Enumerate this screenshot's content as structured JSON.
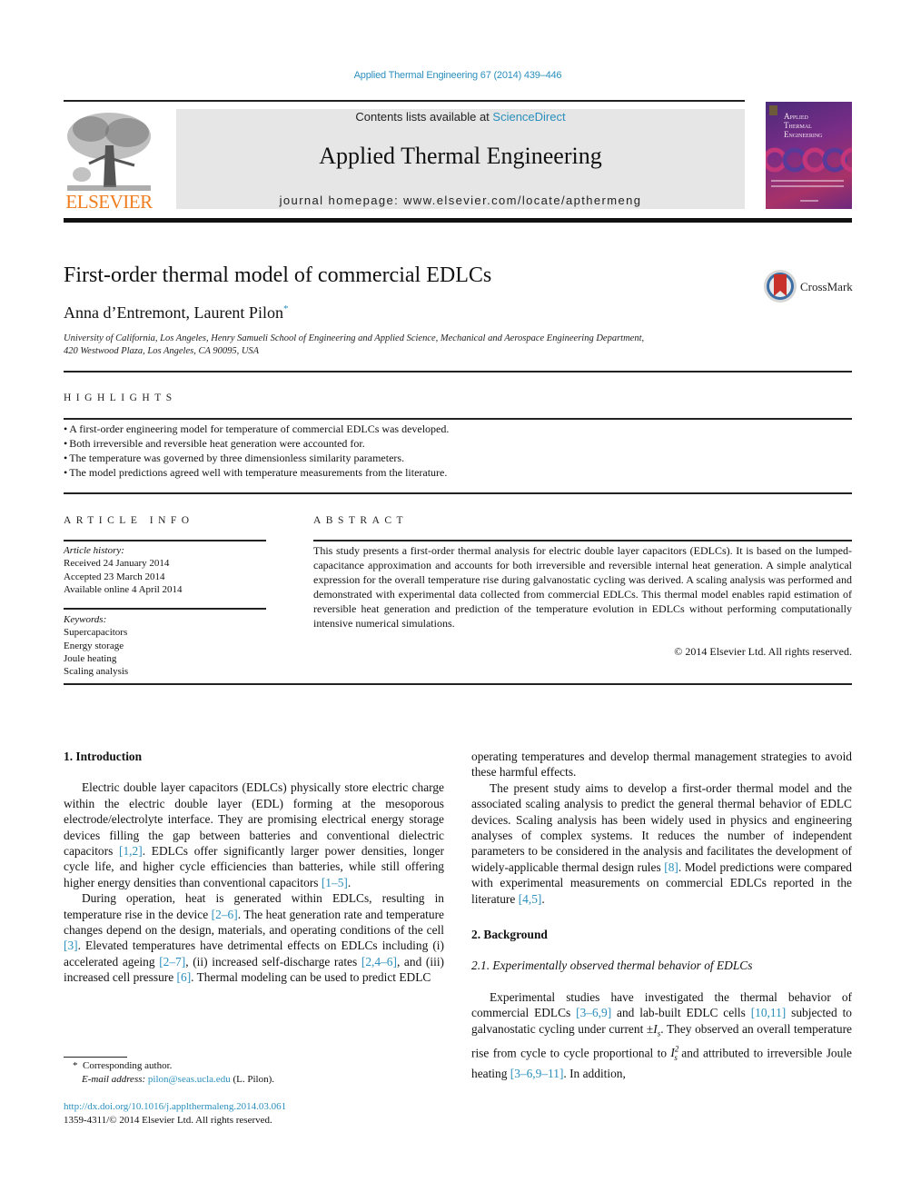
{
  "header": {
    "journal_ref": "Applied Thermal Engineering 67 (2014) 439–446",
    "contents_prefix": "Contents lists available at ",
    "contents_link": "ScienceDirect",
    "journal_name": "Applied Thermal Engineering",
    "homepage_prefix": "journal homepage: ",
    "homepage_url": "www.elsevier.com/locate/apthermeng",
    "publisher_logo_text": "ELSEVIER",
    "cover_title_lines": [
      "Applied",
      "Thermal",
      "Engineering"
    ],
    "brand_color": "#f07d1e",
    "link_color": "#2a8fbd"
  },
  "article": {
    "title": "First-order thermal model of commercial EDLCs",
    "authors": "Anna d’Entremont, Laurent Pilon",
    "author_mark": "*",
    "crossmark_label": "CrossMark",
    "affiliation_line1": "University of California, Los Angeles, Henry Samueli School of Engineering and Applied Science, Mechanical and Aerospace Engineering Department,",
    "affiliation_line2": "420 Westwood Plaza, Los Angeles, CA 90095, USA"
  },
  "highlights": {
    "heading": "HIGHLIGHTS",
    "items": [
      "A first-order engineering model for temperature of commercial EDLCs was developed.",
      "Both irreversible and reversible heat generation were accounted for.",
      "The temperature was governed by three dimensionless similarity parameters.",
      "The model predictions agreed well with temperature measurements from the literature."
    ]
  },
  "article_info": {
    "heading": "ARTICLE INFO",
    "history_label": "Article history:",
    "history": [
      "Received 24 January 2014",
      "Accepted 23 March 2014",
      "Available online 4 April 2014"
    ],
    "keywords_label": "Keywords:",
    "keywords": [
      "Supercapacitors",
      "Energy storage",
      "Joule heating",
      "Scaling analysis"
    ]
  },
  "abstract": {
    "heading": "ABSTRACT",
    "text": "This study presents a first-order thermal analysis for electric double layer capacitors (EDLCs). It is based on the lumped-capacitance approximation and accounts for both irreversible and reversible internal heat generation. A simple analytical expression for the overall temperature rise during galvanostatic cycling was derived. A scaling analysis was performed and demonstrated with experimental data collected from commercial EDLCs. This thermal model enables rapid estimation of reversible heat generation and prediction of the temperature evolution in EDLCs without performing computationally intensive numerical simulations.",
    "copyright": "© 2014 Elsevier Ltd. All rights reserved."
  },
  "body": {
    "sec1_heading": "1.  Introduction",
    "p1": [
      {
        "t": "Electric double layer capacitors (EDLCs) physically store electric charge within the electric double layer (EDL) forming at the mesoporous electrode/electrolyte interface. They are promising electrical energy storage devices filling the gap between batteries and conventional dielectric capacitors "
      },
      {
        "ref": "[1,2]"
      },
      {
        "t": ". EDLCs offer significantly larger power densities, longer cycle life, and higher cycle efficiencies than batteries, while still offering higher energy densities than conventional capacitors "
      },
      {
        "ref": "[1–5]"
      },
      {
        "t": "."
      }
    ],
    "p2": [
      {
        "t": "During operation, heat is generated within EDLCs, resulting in temperature rise in the device "
      },
      {
        "ref": "[2–6]"
      },
      {
        "t": ". The heat generation rate and temperature changes depend on the design, materials, and operating conditions of the cell "
      },
      {
        "ref": "[3]"
      },
      {
        "t": ". Elevated temperatures have detrimental effects on EDLCs including (i) accelerated ageing "
      },
      {
        "ref": "[2–7]"
      },
      {
        "t": ", (ii) increased self-discharge rates "
      },
      {
        "ref": "[2,4–6]"
      },
      {
        "t": ", and (iii) increased cell pressure "
      },
      {
        "ref": "[6]"
      },
      {
        "t": ". Thermal modeling can be used to predict EDLC operating temperatures and develop thermal management strategies to avoid these harmful effects."
      }
    ],
    "p2_left": [
      {
        "t": "During operation, heat is generated within EDLCs, resulting in temperature rise in the device "
      },
      {
        "ref": "[2–6]"
      },
      {
        "t": ". The heat generation rate and temperature changes depend on the design, materials, and operating conditions of the cell "
      },
      {
        "ref": "[3]"
      },
      {
        "t": ". Elevated temperatures have detrimental effects on EDLCs including (i) accelerated ageing "
      },
      {
        "ref": "[2–7]"
      },
      {
        "t": ", (ii) increased self-discharge rates "
      },
      {
        "ref": "[2,4–6]"
      },
      {
        "t": ", and (iii) increased cell pressure "
      },
      {
        "ref": "[6]"
      },
      {
        "t": ". Thermal modeling can be used to predict EDLC"
      }
    ],
    "p2_right": [
      {
        "t": "operating temperatures and develop thermal management strategies to avoid these harmful effects."
      }
    ],
    "p3": [
      {
        "t": "The present study aims to develop a first-order thermal model and the associated scaling analysis to predict the general thermal behavior of EDLC devices. Scaling analysis has been widely used in physics and engineering analyses of complex systems. It reduces the number of independent parameters to be considered in the analysis and facilitates the development of widely-applicable thermal design rules "
      },
      {
        "ref": "[8]"
      },
      {
        "t": ". Model predictions were compared with experimental measurements on commercial EDLCs reported in the literature "
      },
      {
        "ref": "[4,5]"
      },
      {
        "t": "."
      }
    ],
    "sec2_heading": "2.  Background",
    "sec21_heading": "2.1.  Experimentally observed thermal behavior of EDLCs",
    "p4": [
      {
        "t": "Experimental studies have investigated the thermal behavior of commercial EDLCs "
      },
      {
        "ref": "[3–6,9]"
      },
      {
        "t": " and lab-built EDLC cells "
      },
      {
        "ref": "[10,11]"
      },
      {
        "t": " subjected to galvanostatic cycling under current ±"
      },
      {
        "math": "I",
        "sub": "s"
      },
      {
        "t": ". They observed an overall temperature rise from cycle to cycle proportional to "
      },
      {
        "math": "I",
        "sub": "s",
        "sup": "2"
      },
      {
        "t": " and attributed to irreversible Joule heating "
      },
      {
        "ref": "[3–6,9–11]"
      },
      {
        "t": ". In addition,"
      }
    ]
  },
  "footnote": {
    "mark": "*",
    "corresponding": "Corresponding author.",
    "email_label": "E-mail address:",
    "email": "pilon@seas.ucla.edu",
    "email_suffix": " (L. Pilon).",
    "doi_url": "http://dx.doi.org/10.1016/j.applthermaleng.2014.03.061",
    "issn_line": "1359-4311/© 2014 Elsevier Ltd. All rights reserved."
  }
}
